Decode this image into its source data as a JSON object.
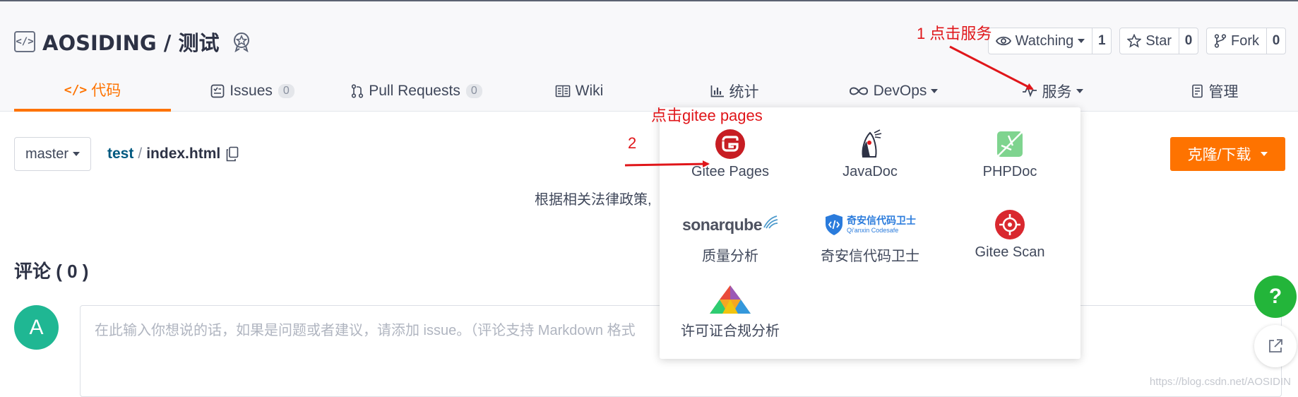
{
  "repo": {
    "title": "AOSIDING / 测试"
  },
  "actions": {
    "watch": {
      "label": "Watching",
      "count": "1"
    },
    "star": {
      "label": "Star",
      "count": "0"
    },
    "fork": {
      "label": "Fork",
      "count": "0"
    }
  },
  "tabs": {
    "code": {
      "label": "代码"
    },
    "issues": {
      "label": "Issues",
      "count": "0"
    },
    "pulls": {
      "label": "Pull Requests",
      "count": "0"
    },
    "wiki": {
      "label": "Wiki"
    },
    "stats": {
      "label": "统计"
    },
    "devops": {
      "label": "DevOps"
    },
    "services": {
      "label": "服务"
    },
    "manage": {
      "label": "管理"
    }
  },
  "file": {
    "branch": "master",
    "dir": "test",
    "separator": "/",
    "name": "index.html",
    "notice": "根据相关法律政策,",
    "clone_label": "克隆/下载"
  },
  "comments": {
    "title": "评论 ( 0 )",
    "avatar_letter": "A",
    "placeholder": "在此输入你想说的话，如果是问题或者建议，请添加 issue。（评论支持 Markdown 格式"
  },
  "services_menu": {
    "items": [
      {
        "label": "Gitee Pages",
        "icon": "gitee-pages-icon"
      },
      {
        "label": "JavaDoc",
        "icon": "javadoc-icon"
      },
      {
        "label": "PHPDoc",
        "icon": "phpdoc-icon"
      },
      {
        "label": "质量分析",
        "icon": "sonarqube-logo",
        "logo_text": "sonarqube"
      },
      {
        "label": "奇安信代码卫士",
        "icon": "qianxin-codesafe-logo",
        "logo_text": "奇安信代码卫士",
        "logo_subtext": "Qi'anxin Codesafe"
      },
      {
        "label": "Gitee Scan",
        "icon": "gitee-scan-icon"
      },
      {
        "label": "许可证合规分析",
        "icon": "license-compliance-icon"
      }
    ]
  },
  "annotations": {
    "step1": "1  点击服务",
    "step2_title": "点击gitee pages",
    "step2_number": "2"
  },
  "floating": {
    "help": "?"
  },
  "watermark": "https://blog.csdn.net/AOSIDIN",
  "colors": {
    "accent": "#fe7300",
    "annotation": "#e0161a",
    "help": "#23b53a",
    "avatar": "#1fb793"
  }
}
